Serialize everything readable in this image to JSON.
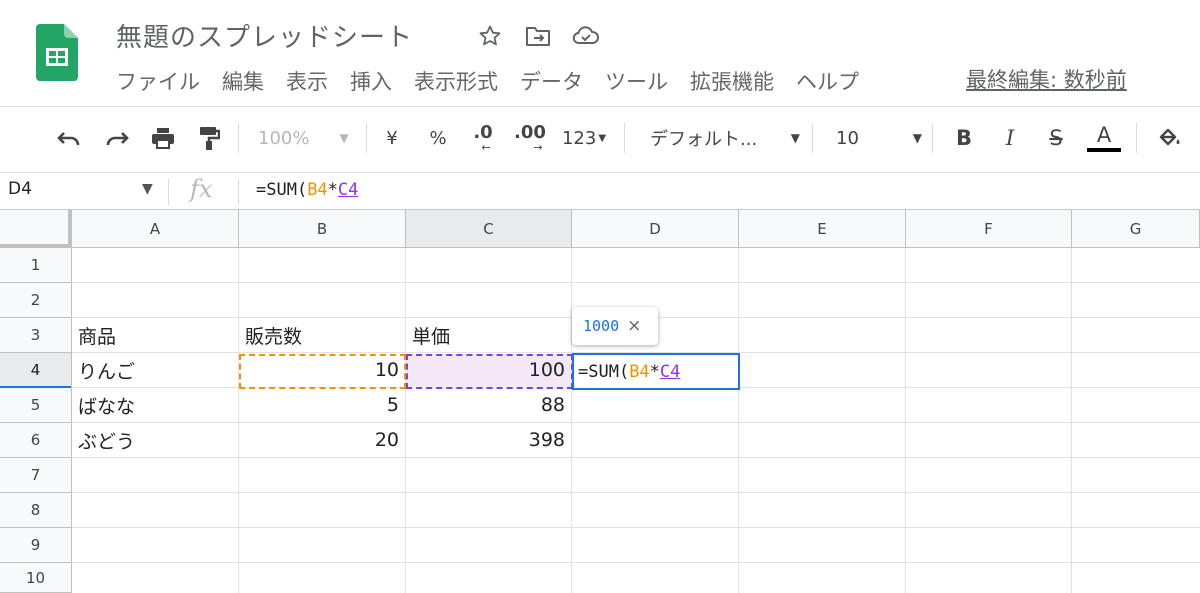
{
  "header": {
    "title": "無題のスプレッドシート",
    "menu": [
      "ファイル",
      "編集",
      "表示",
      "挿入",
      "表示形式",
      "データ",
      "ツール",
      "拡張機能",
      "ヘルプ"
    ],
    "last_edit": "最終編集: 数秒前",
    "icons": [
      "star-icon",
      "move-to-folder-icon",
      "cloud-status-icon"
    ]
  },
  "toolbar": {
    "zoom": "100%",
    "currency": "¥",
    "percent": "%",
    "decrease_decimal": ".0",
    "increase_decimal": ".00",
    "number_format": "123",
    "font": "デフォルト...",
    "font_size": "10",
    "bold": "B",
    "italic": "I",
    "strikethrough": "S",
    "text_color": "A",
    "text_color_value": "#000000"
  },
  "formula_bar": {
    "name_box": "D4",
    "fx": "fx",
    "prefix": "=SUM(",
    "ref1": "B4",
    "op": "*",
    "ref2": "C4"
  },
  "grid": {
    "columns": [
      "A",
      "B",
      "C",
      "D",
      "E",
      "F",
      "G"
    ],
    "selected_column": "C",
    "rows": [
      "1",
      "2",
      "3",
      "4",
      "5",
      "6",
      "7",
      "8",
      "9",
      "10"
    ],
    "selected_row": "4",
    "headers": {
      "a3": "商品",
      "b3": "販売数",
      "c3": "単価"
    },
    "data": [
      {
        "name": "りんご",
        "qty": "10",
        "price": "100"
      },
      {
        "name": "ばなな",
        "qty": "5",
        "price": "88"
      },
      {
        "name": "ぶどう",
        "qty": "20",
        "price": "398"
      }
    ],
    "active_cell": {
      "prefix": "=SUM(",
      "ref1": "B4",
      "op": "*",
      "ref2": "C4"
    },
    "tooltip": {
      "value": "1000",
      "close": "×"
    }
  },
  "colors": {
    "ref_b": "#f09300",
    "ref_c": "#9334e6",
    "active_border": "#1a73e8",
    "c4_fill": "#f3e8f5"
  }
}
